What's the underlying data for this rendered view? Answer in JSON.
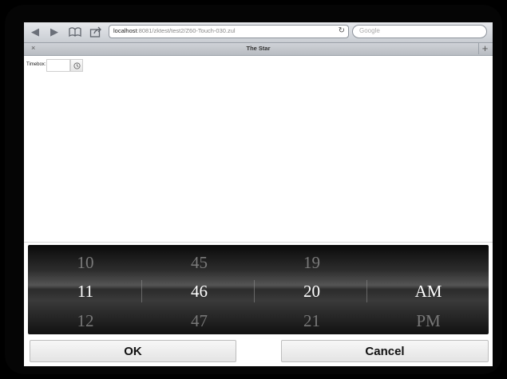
{
  "browser": {
    "url_host": "localhost",
    "url_path": ":8081/zktest/test2/Z60-Touch-030.zul",
    "search_placeholder": "Google",
    "tab_close": "×",
    "tab_title": "The Star",
    "tab_add": "+"
  },
  "page": {
    "timebox_label": "Timebox:",
    "timebox_value": ""
  },
  "picker": {
    "hour": {
      "prev": "10",
      "selected": "11",
      "next": "12"
    },
    "minute": {
      "prev": "45",
      "selected": "46",
      "next": "47"
    },
    "second": {
      "prev": "19",
      "selected": "20",
      "next": "21"
    },
    "ampm": {
      "prev": "",
      "selected": "AM",
      "next": "PM"
    }
  },
  "buttons": {
    "ok": "OK",
    "cancel": "Cancel"
  }
}
